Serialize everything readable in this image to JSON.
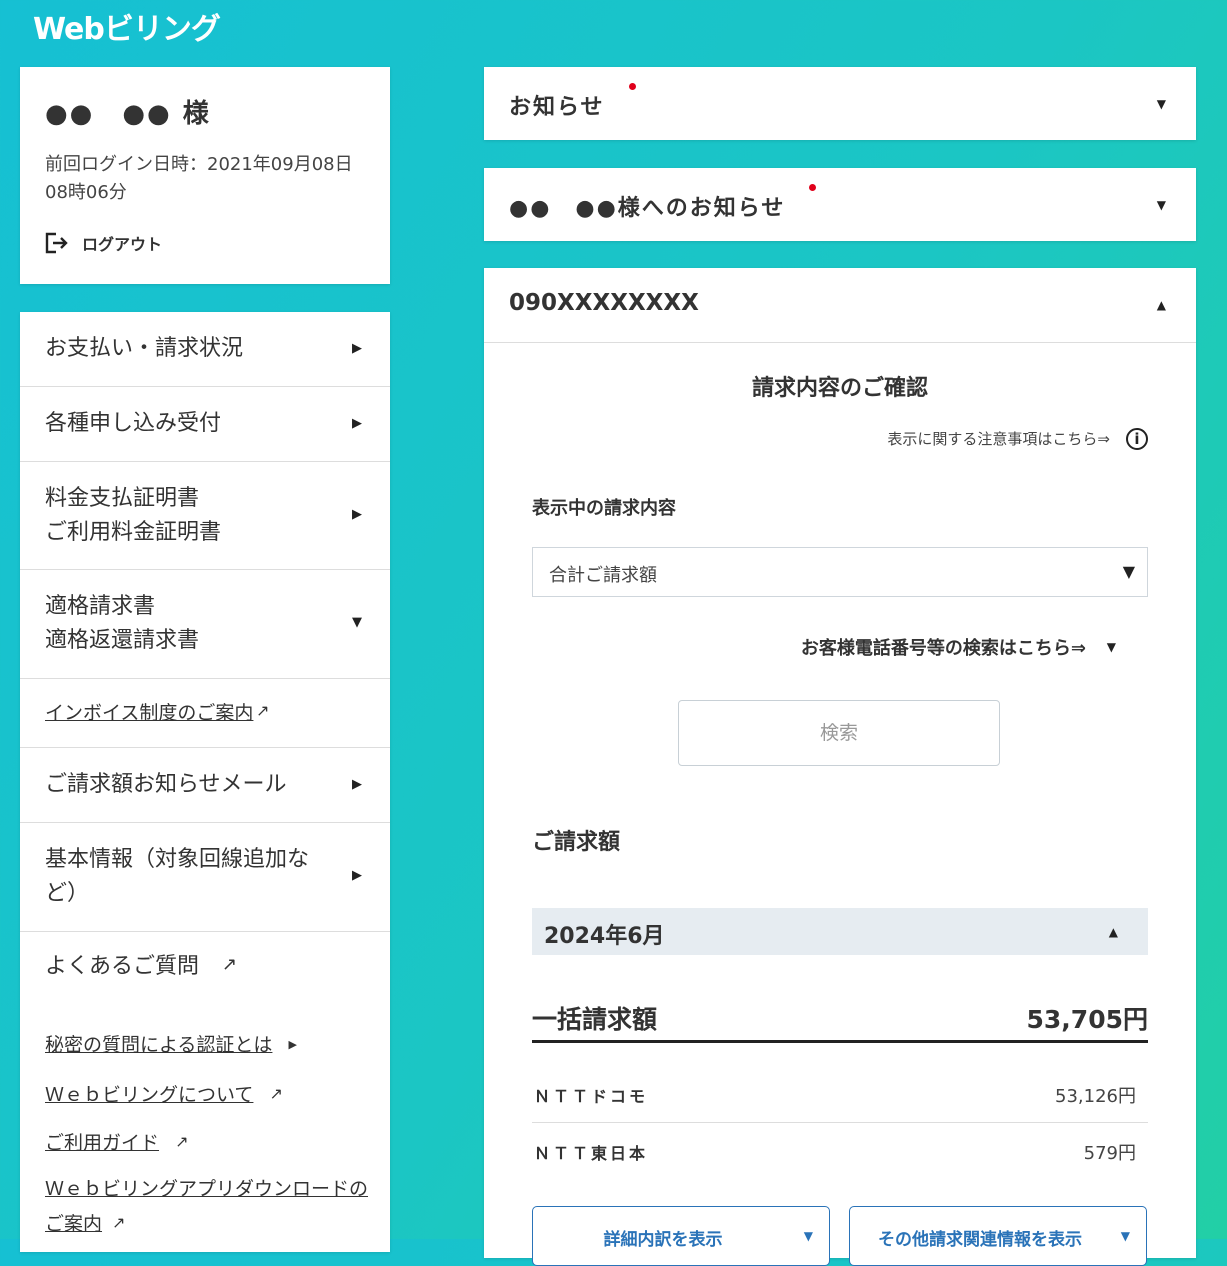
{
  "app": {
    "logo": "Webビリング"
  },
  "user": {
    "name": "●●　●● 様",
    "last_login": "前回ログイン日時：2021年09月08日 08時06分",
    "logout_label": "ログアウト"
  },
  "menu": {
    "items": [
      {
        "label": "お支払い・請求状況",
        "icon": "chevron-right-icon"
      },
      {
        "label": "各種申し込み受付",
        "icon": "chevron-right-icon"
      },
      {
        "label_line1": "料金支払証明書",
        "label_line2": "ご利用料金証明書",
        "icon": "chevron-right-icon"
      },
      {
        "label_line1": "適格請求書",
        "label_line2": "適格返還請求書",
        "icon": "chevron-down-icon"
      },
      {
        "label": "インボイス制度のご案内",
        "icon": "external-link-icon"
      },
      {
        "label": "ご請求額お知らせメール",
        "icon": "chevron-right-icon"
      },
      {
        "label_line1": "基本情報（対象回線追加な",
        "label_line2": "ど）",
        "icon": "chevron-right-icon"
      },
      {
        "label": "よくあるご質問",
        "icon": "external-link-icon"
      }
    ],
    "links": [
      {
        "label": "秘密の質問による認証とは"
      },
      {
        "label": "Ｗｅｂビリングについて"
      },
      {
        "label": "ご利用ガイド"
      },
      {
        "label_line1": "Ｗｅｂビリングアプリダウンロードの",
        "label_line2": "ご案内"
      }
    ]
  },
  "notices": {
    "general": "お知らせ",
    "personal": "●●　●●様へのお知らせ"
  },
  "phone_panel": {
    "number": "090XXXXXXXX",
    "section_title": "請求内容のご確認",
    "notice_link": "表示に関する注意事項はこちら⇒",
    "display_label": "表示中の請求内容",
    "select_value": "合計ご請求額",
    "search_toggle": "お客様電話番号等の検索はこちら⇒",
    "search_button": "検索",
    "bill_label": "ご請求額",
    "month": "2024年6月",
    "total_label": "一括請求額",
    "total_value": "53,705円",
    "rows": [
      {
        "name": "ＮＴＴドコモ",
        "amount": "53,126円"
      },
      {
        "name": "ＮＴＴ東日本",
        "amount": "579円"
      }
    ],
    "buttons": {
      "detail": "詳細内訳を表示",
      "other": "その他請求関連情報を表示"
    }
  },
  "colors": {
    "bg_start": "#16c0d3",
    "bg_end": "#22cfa6",
    "notice_dot": "#e0001b",
    "button_blue": "#2a73b8"
  }
}
